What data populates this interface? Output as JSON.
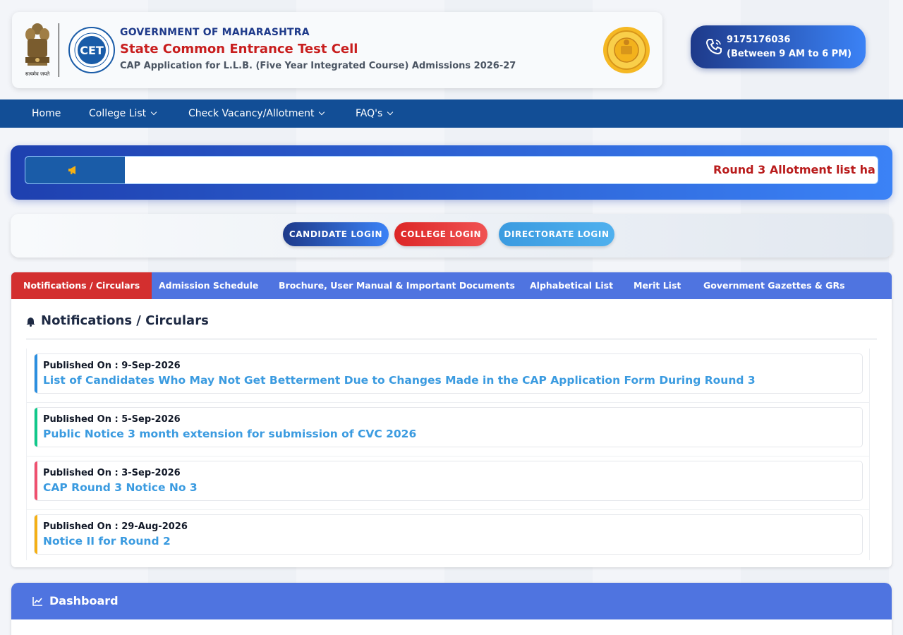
{
  "header": {
    "gov": "GOVERNMENT OF MAHARASHTRA",
    "cell": "State Common Entrance Test Cell",
    "subtitle": "CAP Application for L.L.B. (Five Year Integrated Course) Admissions 2026-27",
    "emblem_caption": "सत्यमेव जयते",
    "cet_logo_text": "CET"
  },
  "helpline": {
    "number": "9175176036",
    "hours": "(Between 9 AM to 6 PM)"
  },
  "nav": {
    "home": "Home",
    "college_list": "College List",
    "vacancy": "Check Vacancy/Allotment",
    "faqs": "FAQ's"
  },
  "ticker": {
    "text": "Round 3 Allotment list ha"
  },
  "login": {
    "candidate": "CANDIDATE LOGIN",
    "college": "COLLEGE LOGIN",
    "directorate": "DIRECTORATE LOGIN"
  },
  "tabs": [
    "Notifications / Circulars",
    "Admission Schedule",
    "Brochure, User Manual & Important Documents",
    "Alphabetical List",
    "Merit List",
    "Government Gazettes & GRs"
  ],
  "section_title": "Notifications / Circulars",
  "notifications": [
    {
      "date": "Published On : 9-Sep-2026",
      "title": "List of Candidates Who May Not Get Betterment Due to Changes Made in the CAP Application Form During Round 3",
      "color": "#2b8fe0"
    },
    {
      "date": "Published On : 5-Sep-2026",
      "title": "Public Notice 3 month extension for submission of CVC 2026",
      "color": "#10c98a"
    },
    {
      "date": "Published On : 3-Sep-2026",
      "title": "CAP Round 3 Notice No 3",
      "color": "#f0506e"
    },
    {
      "date": "Published On : 29-Aug-2026",
      "title": "Notice II for Round 2",
      "color": "#f5b014"
    }
  ],
  "dashboard": {
    "title": "Dashboard"
  },
  "colors": {
    "primary": "#1e3a8a",
    "nav": "#124e96",
    "tab_bar": "#4f74e0",
    "tab_active": "#d32f2f",
    "link": "#3b9be0"
  }
}
